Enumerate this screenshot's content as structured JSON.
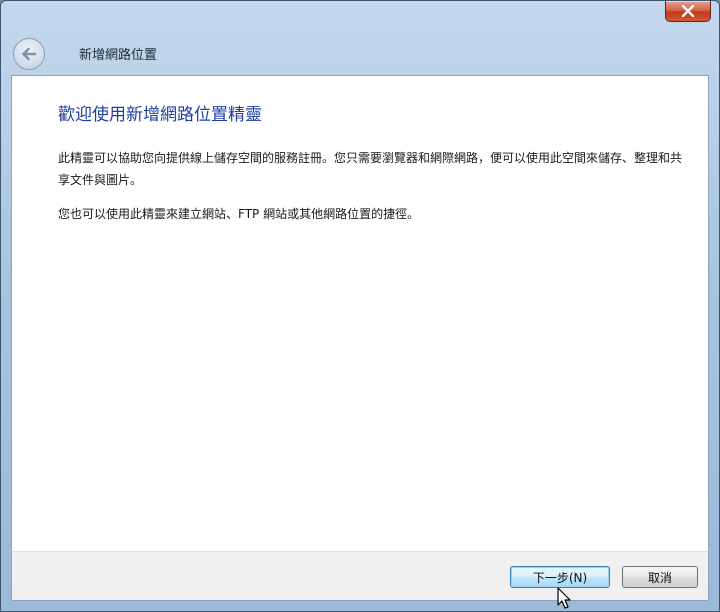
{
  "window": {
    "title": "新增網路位置",
    "close_icon": "close-icon",
    "back_icon": "back-arrow-icon"
  },
  "content": {
    "heading": "歡迎使用新增網路位置精靈",
    "paragraph1": "此精靈可以協助您向提供線上儲存空間的服務註冊。您只需要瀏覽器和網際網路，便可以使用此空間來儲存、整理和共享文件與圖片。",
    "paragraph2": "您也可以使用此精靈來建立網站、FTP 網站或其他網路位置的捷徑。"
  },
  "footer": {
    "next_label": "下一步(N)",
    "cancel_label": "取消"
  },
  "colors": {
    "heading": "#1e3fa0",
    "close_button": "#c2381c",
    "frame": "#a9c4df"
  }
}
